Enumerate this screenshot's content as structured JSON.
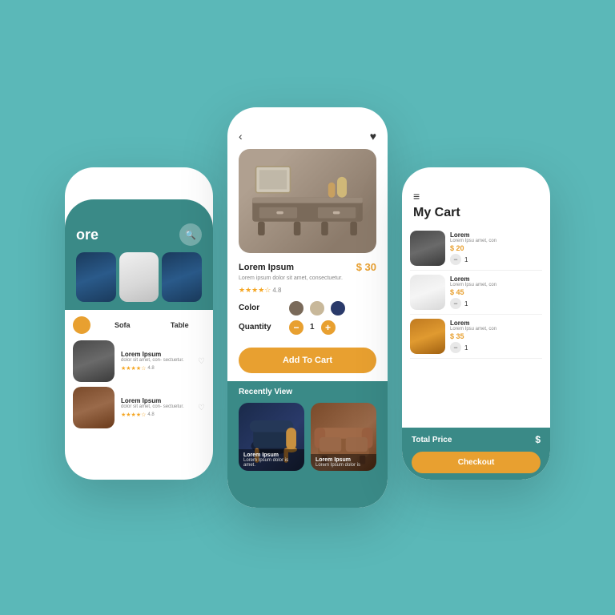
{
  "background_color": "#5bb8b8",
  "phone1": {
    "title": "ore",
    "search_icon": "🔍",
    "categories": [
      {
        "label": "",
        "type": "dot"
      },
      {
        "label": "Sofa",
        "type": "text"
      },
      {
        "label": "Table",
        "type": "text"
      }
    ],
    "products": [
      {
        "name": "Lorem Ipsum",
        "desc": "dolor sit\namet, con-\nsectuetur.",
        "rating": "4.8",
        "stars": "★★★★☆"
      },
      {
        "name": "Lorem Ipsum",
        "desc": "dolor sit\namet, con-\nsectuetur.",
        "rating": "4.8",
        "stars": "★★★★☆"
      }
    ]
  },
  "phone2": {
    "back_icon": "‹",
    "heart_icon": "♥",
    "product": {
      "name": "Lorem Ipsum",
      "desc": "Lorem ipsum dolor sit\namet, consectuetur.",
      "price": "$ 30",
      "rating": "4.8",
      "stars": "★★★★☆",
      "colors": [
        {
          "name": "brown",
          "hex": "#7a6a5a"
        },
        {
          "name": "tan",
          "hex": "#c8b89a"
        },
        {
          "name": "navy",
          "hex": "#2a3a6a"
        }
      ],
      "quantity": 1
    },
    "color_label": "Color",
    "quantity_label": "Quantity",
    "add_to_cart_label": "Add To Cart",
    "recently_view_title": "Recently View",
    "recent_items": [
      {
        "name": "Lorem Ipsum",
        "desc": "Lorem Ipsum dolor is amet.",
        "color": "#1a2a4a"
      },
      {
        "name": "Lorem Ipsum",
        "desc": "Lorem Ipsum dolor is",
        "color": "#8a5a3a"
      }
    ]
  },
  "phone3": {
    "hamburger": "≡",
    "title": "My Cart",
    "items": [
      {
        "name": "Lorem",
        "desc": "Lorem Ipsu\namet, con",
        "price": "$ 20",
        "quantity": 1,
        "img_color": "#5a5a5a"
      },
      {
        "name": "Lorem",
        "desc": "Lorem Ipsu\namet, con",
        "price": "$ 45",
        "quantity": 1,
        "img_color": "#e0e0e0"
      },
      {
        "name": "Lorem",
        "desc": "Lorem Ipsu\namet, con",
        "price": "$ 35",
        "quantity": 1,
        "img_color": "#c07a20"
      }
    ],
    "total_price_label": "Total Price",
    "total_price": "$",
    "checkout_label": "Checkout"
  }
}
